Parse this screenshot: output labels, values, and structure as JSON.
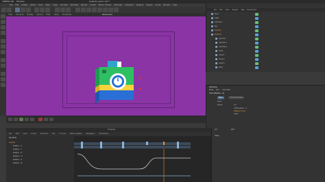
{
  "window": {
    "app_name": "CINEMA 4D",
    "menu_first": "Window",
    "doc_title": "polaroid_anim.c4d *"
  },
  "menu": {
    "items": [
      "File",
      "Edit",
      "Create",
      "Select",
      "Tools",
      "Mesh",
      "Snap",
      "Animate",
      "Simulate",
      "Render",
      "Sculpt",
      "Motion Tracker",
      "MoGraph",
      "Character",
      "Pipeline",
      "Plugins",
      "Script",
      "Window",
      "Help"
    ]
  },
  "viewport": {
    "menu": [
      "View",
      "Cameras",
      "Display",
      "Options",
      "Filter",
      "Panel",
      "ProRender"
    ],
    "label": "Perspective",
    "background_color": "#8a34a6"
  },
  "object_manager": {
    "tabs": [
      "File",
      "Edit",
      "View",
      "Objects",
      "Tags",
      "Bookmarks"
    ],
    "rows": [
      {
        "name": "Floor",
        "color": "#bdbdbd"
      },
      {
        "name": "Light",
        "color": "#bdbdbd"
      },
      {
        "name": "Camera.1",
        "color": "#bdbdbd"
      },
      {
        "name": "Sky",
        "color": "#bdbdbd"
      },
      {
        "name": "Camera",
        "color": "#e8a23a"
      },
      {
        "name": "Polaroid",
        "color": "#e8a23a"
      },
      {
        "name": "Cylinder",
        "color": "#bdbdbd"
      },
      {
        "name": "Cylinder.1",
        "color": "#bdbdbd"
      },
      {
        "name": "Cylinder.2",
        "color": "#bdbdbd"
      },
      {
        "name": "Cube",
        "color": "#bdbdbd"
      },
      {
        "name": "Cube.1",
        "color": "#bdbdbd"
      },
      {
        "name": "Cube.2",
        "color": "#bdbdbd"
      },
      {
        "name": "Cube.3",
        "color": "#bdbdbd"
      },
      {
        "name": "Body",
        "color": "#bdbdbd"
      }
    ]
  },
  "attributes": {
    "header": "Attributes",
    "tabs": [
      "Mode",
      "Edit",
      "User Data"
    ],
    "object_label": "Track [Position . X]",
    "lines": [
      "Basic",
      "Track Properties",
      "Track",
      "Frame",
      "CTB Position . X",
      "Display Curve",
      "Layer"
    ],
    "value_frame": "0 F",
    "value_label": "Value"
  },
  "timeline": {
    "title": "Timeline",
    "menu": [
      "File",
      "Edit",
      "View",
      "Frame",
      "Functions",
      "Key",
      "F-Curve",
      "Motion System",
      "Navigation",
      "Bookmarks"
    ],
    "tracks": [
      "Key Mode",
      "Polaroid",
      "Position . X",
      "Position . Y",
      "Position . Z",
      "Rotation . H",
      "Rotation . P",
      "Rotation . B"
    ],
    "frame": "0 F",
    "end_frame": "90 F"
  },
  "colors": {
    "accent_key": "#8ab4d8",
    "current_time": "#e89a2a",
    "selection": "#e8a23a"
  }
}
